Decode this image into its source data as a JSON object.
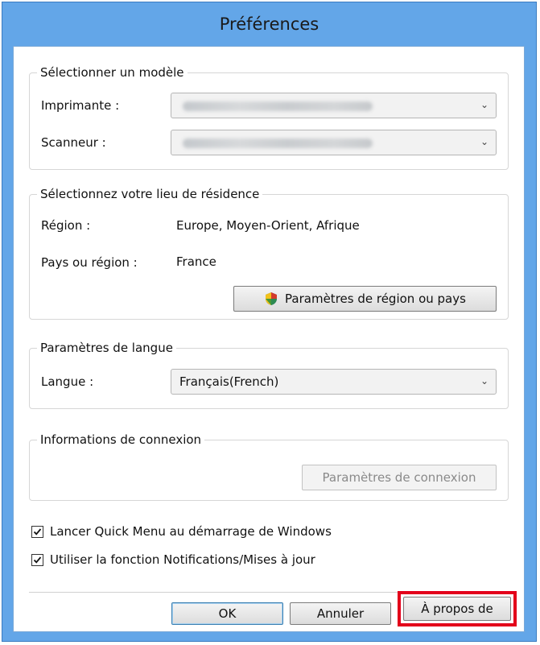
{
  "window": {
    "title": "Préférences"
  },
  "model_group": {
    "title": "Sélectionner un modèle",
    "printer_label": "Imprimante :",
    "scanner_label": "Scanneur :"
  },
  "residence_group": {
    "title": "Sélectionnez votre lieu de résidence",
    "region_label": "Région :",
    "region_value": "Europe, Moyen-Orient, Afrique",
    "country_label": "Pays ou région :",
    "country_value": "France",
    "settings_button": "Paramètres de région ou pays"
  },
  "language_group": {
    "title": "Paramètres de langue",
    "language_label": "Langue :",
    "language_value": "Français(French)"
  },
  "connection_group": {
    "title": "Informations de connexion",
    "settings_button": "Paramètres de connexion"
  },
  "options": [
    {
      "label": "Lancer Quick Menu au démarrage de Windows",
      "checked": true
    },
    {
      "label": "Utiliser la fonction Notifications/Mises à jour",
      "checked": true
    }
  ],
  "footer": {
    "ok_label": "OK",
    "cancel_label": "Annuler",
    "about_label": "À propos de"
  },
  "colors": {
    "window_frame": "#63a6e8",
    "highlight": "#e3001b"
  }
}
